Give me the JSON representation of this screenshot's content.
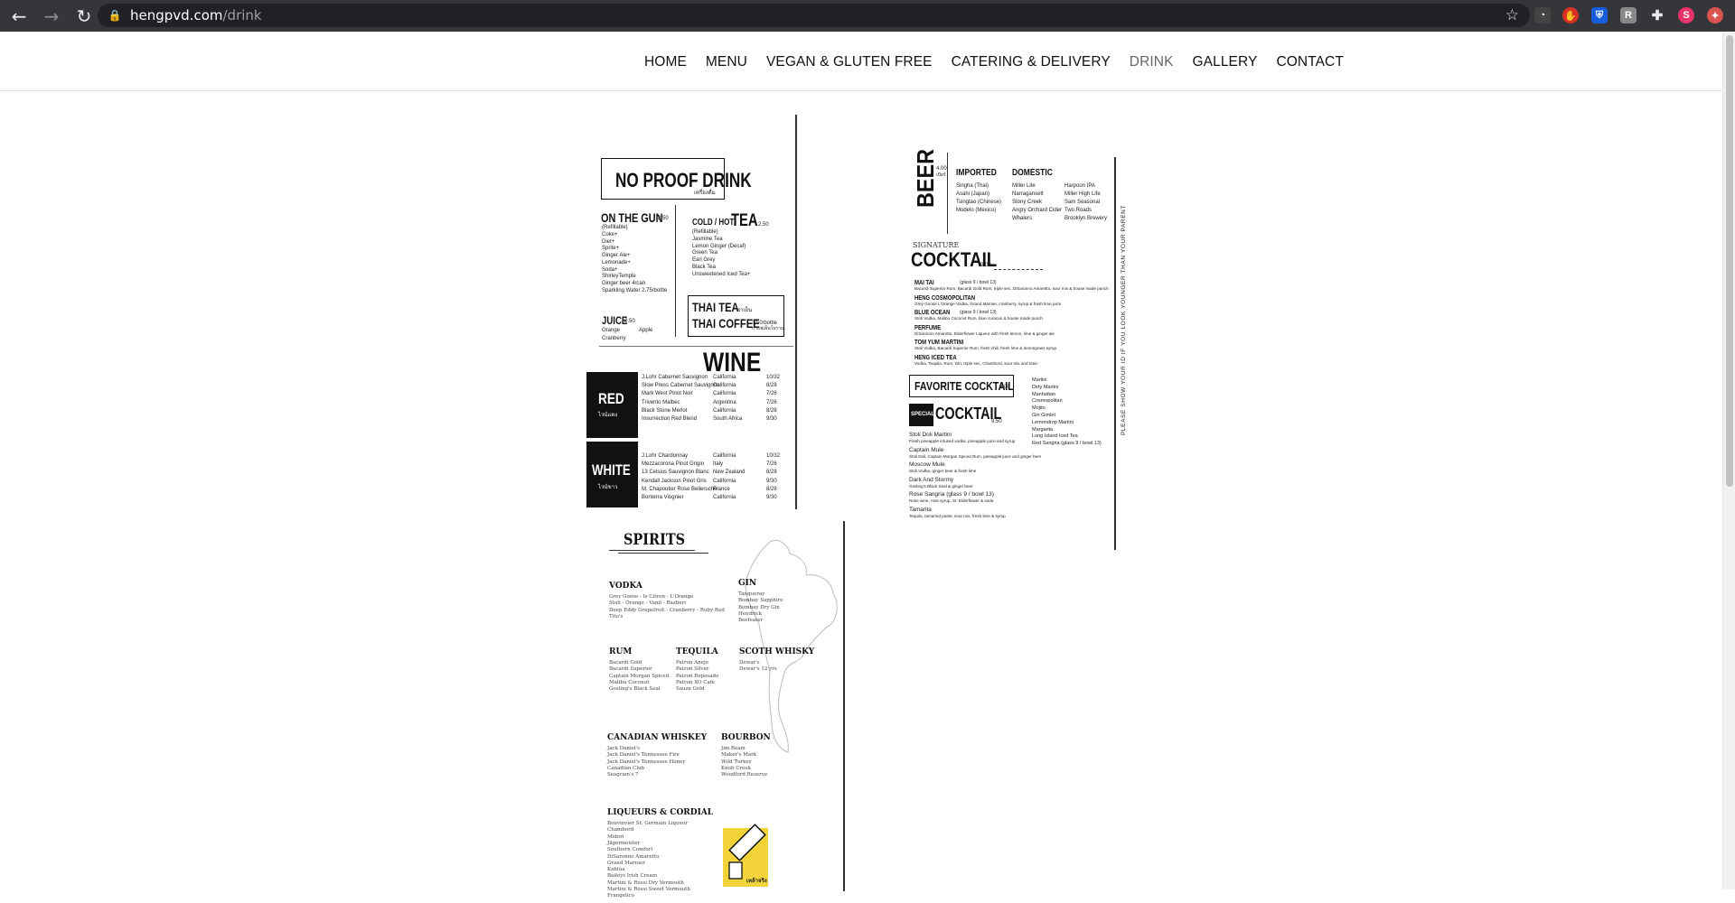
{
  "browser": {
    "url_host": "hengpvd.com",
    "url_path": "/drink",
    "profile_initial": "S"
  },
  "nav": {
    "items": [
      "HOME",
      "MENU",
      "VEGAN & GLUTEN FREE",
      "CATERING & DELIVERY",
      "DRINK",
      "GALLERY",
      "CONTACT"
    ],
    "active": "DRINK"
  },
  "noproof": {
    "title": "NO PROOF DRINK",
    "title_thai": "เครื่องดื่ม",
    "gun_title": "ON THE GUN",
    "gun_price": "2.50",
    "gun_refill": "(Refillable)",
    "gun_items": [
      "Coke+",
      "Diet+",
      "Sprite+",
      "Ginger Ale+",
      "Lemonade+",
      "Soda+",
      "ShirleyTemple",
      "Ginger beer 4/can",
      "Sparkling Water 2.75/bottle"
    ],
    "juice_title": "JUICE",
    "juice_price": "2.50",
    "juice_items": [
      "Orange",
      "Apple",
      "Cranberry"
    ],
    "tea_title_a": "COLD / HOT",
    "tea_title_b": "TEA",
    "tea_price": "2.50",
    "tea_refill": "(Refillable)",
    "tea_items": [
      "Jasmine Tea",
      "Lemon Ginger (Decaf)",
      "Green Tea",
      "Earl Grey",
      "Black Tea",
      "Unsweetened Iced Tea+"
    ],
    "thai_tea": "THAI TEA",
    "thai_coffee": "THAI COFFEE",
    "thai_price": "3.50/bottle",
    "thai_tea_th": "ชาเย็น",
    "thai_coffee_th": "กาแฟเย็นโบราณ"
  },
  "wine": {
    "title": "WINE",
    "red_label": "RED",
    "red_thai": "ไวน์แดง",
    "red": [
      [
        "J.Lohr Cabernet Sauvignon",
        "California",
        "10/32"
      ],
      [
        "Slow Press Cabernet Sauvignon",
        "California",
        "8/28"
      ],
      [
        "Mark West Pinot Noir",
        "California",
        "7/26"
      ],
      [
        "Trivento Malbec",
        "Argentina",
        "7/26"
      ],
      [
        "Black Stone Merlot",
        "California",
        "8/28"
      ],
      [
        "Insurrection Red Blend",
        "South Africa",
        "9/30"
      ]
    ],
    "white_label": "WHITE",
    "white_thai": "ไวน์ขาว",
    "white": [
      [
        "J.Lohr Chardonnay",
        "California",
        "10/32"
      ],
      [
        "Mezzacorona Pinot Grigio",
        "Italy",
        "7/26"
      ],
      [
        "13 Celsius Sauvignon Blanc",
        "New Zealand",
        "8/28"
      ],
      [
        "Kendall Jackson Pinot Gris",
        "California",
        "9/30"
      ],
      [
        "M. Chapoutier Rose Belleruche",
        "France",
        "8/28"
      ],
      [
        "Bonterra Viognier",
        "California",
        "9/30"
      ]
    ]
  },
  "beer": {
    "title": "BEER",
    "price": "4.00",
    "price_th": "เบียร์",
    "imported_title": "IMPORTED",
    "imported": [
      "Singha (Thai)",
      "Asahi (Japan)",
      "Tsingtao (Chinese)",
      "Modelo (Mexico)"
    ],
    "domestic_title": "DOMESTIC",
    "domestic_a": [
      "Miller Lite",
      "Narragansett",
      "Stony Creek",
      "Angry Orchard Cider",
      "Whalers"
    ],
    "domestic_b": [
      "Harpoon IPA",
      "Miller High Life",
      "Sam Seasonal",
      "Two Roads",
      "Brooklyn Brewery"
    ]
  },
  "cocktail": {
    "signature": "SIGNATURE",
    "title": "COCKTAIL",
    "price": "9.00",
    "items": [
      {
        "name": "MAI TAI",
        "note": "(glass 9 / bowl 13)",
        "desc": "Bacardi Superior Rum, Bacardi Gold Rum, triple sec, DiSaronno Amaretto, sour mix & house made punch"
      },
      {
        "name": "HENG COSMOPOLITAN",
        "note": "",
        "desc": "Grey Goose L'Orange Vodka, Grand Marnier, cranberry, syrup & fresh lime juice"
      },
      {
        "name": "BLUE OCEAN",
        "note": "(glass 9 / bowl 13)",
        "desc": "Stoli Vodka, Malibu Coconut Rum, blue curacao & house made punch"
      },
      {
        "name": "PERFUME",
        "note": "",
        "desc": "DiSaronno Amaretto, Elderflower Liqueur with fresh lemon, lime & ginger ale"
      },
      {
        "name": "TOM YUM MARTINI",
        "note": "",
        "desc": "Stoli Vodka, Bacardi Superior Rum, fresh chili, fresh lime & lemongrass syrup"
      },
      {
        "name": "HENG ICED TEA",
        "note": "",
        "desc": "Vodka, Tequila, Rum, Gin, triple sec, Chambord, sour mix and tonic"
      }
    ],
    "favorite_title": "FAVORITE COCKTAIL",
    "favorite_price": "9.00",
    "favorite_a": [
      "Martini",
      "Dirty Martini",
      "Manhattan",
      "Cosmopolitan",
      "Mojito",
      "Gin Gimlet",
      "Lemondrop Martini",
      "Margarita",
      "Long Island Iced Tea"
    ],
    "favorite_b": "Red Sangria (glass 9 / bowl 13)",
    "special_badge": "SPECIAL",
    "special_title": "COCKTAIL",
    "special_price": "9.50",
    "special": [
      {
        "name": "Stoli Doli Martini",
        "desc": "Fresh pineapple infused vodka, pineapple juice and syrup"
      },
      {
        "name": "Captain Mule",
        "desc": "Stoli Doli, Captain Morgan Spiced Rum, pineapple juice and ginger beer"
      },
      {
        "name": "Moscow Mule",
        "desc": "Stoli Vodka, ginger beer & fresh lime"
      },
      {
        "name": "Dark And Stormy",
        "desc": "Gosling's Black Seal & ginger beer"
      },
      {
        "name": "Rose Sangria (glass 9 / bowl 13)",
        "desc": "Rose wine, rose syrup, St. Elderflower & soda"
      },
      {
        "name": "Tamarita",
        "desc": "Tequila, tamarind paste, sour mix, fresh lime & syrup"
      }
    ],
    "id_note": "PLEASE SHOW YOUR ID IF YOU LOOK YOUNGER THAN YOUR PARENT"
  },
  "spirits": {
    "title": "SPIRITS",
    "vodka_title": "VODKA",
    "vodka": [
      "Grey Goose - le Citron - L'Orange",
      "Stoli - Orange - Vanil - Razberi",
      "Deep Eddy Grapefruit - Cranberry - Ruby Red",
      "Tito's"
    ],
    "gin_title": "GIN",
    "gin": [
      "Tanqueray",
      "Bombay Sapphire",
      "Bombay Dry Gin",
      "Hendrick",
      "Beefeater"
    ],
    "rum_title": "RUM",
    "rum": [
      "Bacardi Gold",
      "Bacardi Superior",
      "Captain Morgan Spiced",
      "Malibu Coconut",
      "Gosling's Black Seal"
    ],
    "tequila_title": "TEQUILA",
    "tequila": [
      "Patron Anejo",
      "Patron Silver",
      "Patron Reposado",
      "Patron XO Cafe",
      "Sauza Gold"
    ],
    "scotch_title": "SCOTH WHISKY",
    "scotch": [
      "Dewar's",
      "Dewar's 12 yrs"
    ],
    "canadian_title": "CANADIAN WHISKEY",
    "canadian": [
      "Jack Daniel's",
      "Jack Daniel's Tennessee Fire",
      "Jack Daniel's Tennessee Honey",
      "Canadian Club",
      "Seagram's 7"
    ],
    "bourbon_title": "BOURBON",
    "bourbon": [
      "Jim Beam",
      "Maker's Mark",
      "Wild Turkey",
      "Knob Creek",
      "Woodford Reserve"
    ],
    "liqueur_title": "LIQUEURS & CORDIAL",
    "liqueur": [
      "Bouvinvier St. Germain Liqueur",
      "Chambord",
      "Midori",
      "Jägermeister",
      "Southern Comfort",
      "DiSaronno Amaretto",
      "Grand Marnier",
      "Kahlúa",
      "Baileys Irish Cream",
      "Martini & Rossi Dry Vermouth",
      "Martini & Rossi Sweet Vermouth",
      "Frangelico"
    ],
    "liqueur_img_label": "เหล้าจริง"
  }
}
